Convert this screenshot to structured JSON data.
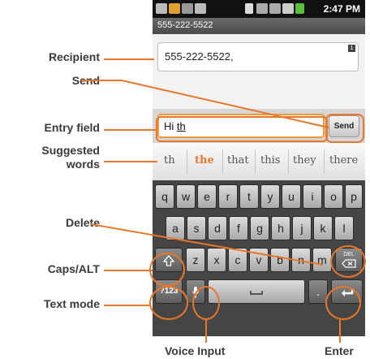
{
  "callouts": {
    "recipient": "Recipient",
    "send": "Send",
    "entry_field": "Entry field",
    "suggested_line1": "Suggested",
    "suggested_line2": "words",
    "delete": "Delete",
    "caps_alt": "Caps/ALT",
    "text_mode": "Text mode",
    "voice_input": "Voice Input",
    "enter": "Enter"
  },
  "status_bar": {
    "time": "2:47 PM"
  },
  "title_bar": {
    "title": "555-222-5522"
  },
  "recipient": {
    "value": "555-222-5522,",
    "badge": "1"
  },
  "compose": {
    "typed": "Hi ",
    "composing": "th",
    "send_label": "Send"
  },
  "suggestions": [
    "th",
    "the",
    "that",
    "this",
    "they",
    "there"
  ],
  "selected_suggestion_index": 1,
  "keyboard": {
    "row1": [
      "q",
      "w",
      "e",
      "r",
      "t",
      "y",
      "u",
      "i",
      "o",
      "p"
    ],
    "row2": [
      "a",
      "s",
      "d",
      "f",
      "g",
      "h",
      "j",
      "k",
      "l"
    ],
    "row3": [
      "z",
      "x",
      "c",
      "v",
      "b",
      "n",
      "m"
    ],
    "shift_icon": "shift-icon",
    "delete_icon": "backspace-icon",
    "delete_alt_label": "DEL",
    "mode_label": "?123",
    "mic_icon": "microphone-icon",
    "space_icon": "space-icon",
    "period_label": ".",
    "enter_icon": "enter-arrow-icon"
  },
  "colors": {
    "accent": "#e8772a",
    "callout_text": "#3a3a3a"
  }
}
